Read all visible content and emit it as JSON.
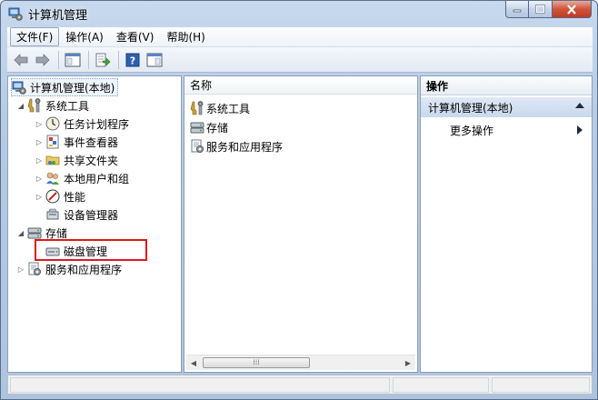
{
  "window": {
    "title": "计算机管理"
  },
  "menu": [
    {
      "label": "文件(F)"
    },
    {
      "label": "操作(A)"
    },
    {
      "label": "查看(V)"
    },
    {
      "label": "帮助(H)"
    }
  ],
  "tree": {
    "root": "计算机管理(本地)",
    "system_tools": "系统工具",
    "task_scheduler": "任务计划程序",
    "event_viewer": "事件查看器",
    "shared_folders": "共享文件夹",
    "local_users": "本地用户和组",
    "performance": "性能",
    "device_manager": "设备管理器",
    "storage": "存储",
    "disk_management": "磁盘管理",
    "services_apps": "服务和应用程序"
  },
  "list": {
    "column_name": "名称",
    "items": [
      "系统工具",
      "存储",
      "服务和应用程序"
    ]
  },
  "actions": {
    "header": "操作",
    "section": "计算机管理(本地)",
    "more": "更多操作"
  },
  "colors": {
    "highlight_border": "#e0171f",
    "close_button": "#c23a22"
  }
}
